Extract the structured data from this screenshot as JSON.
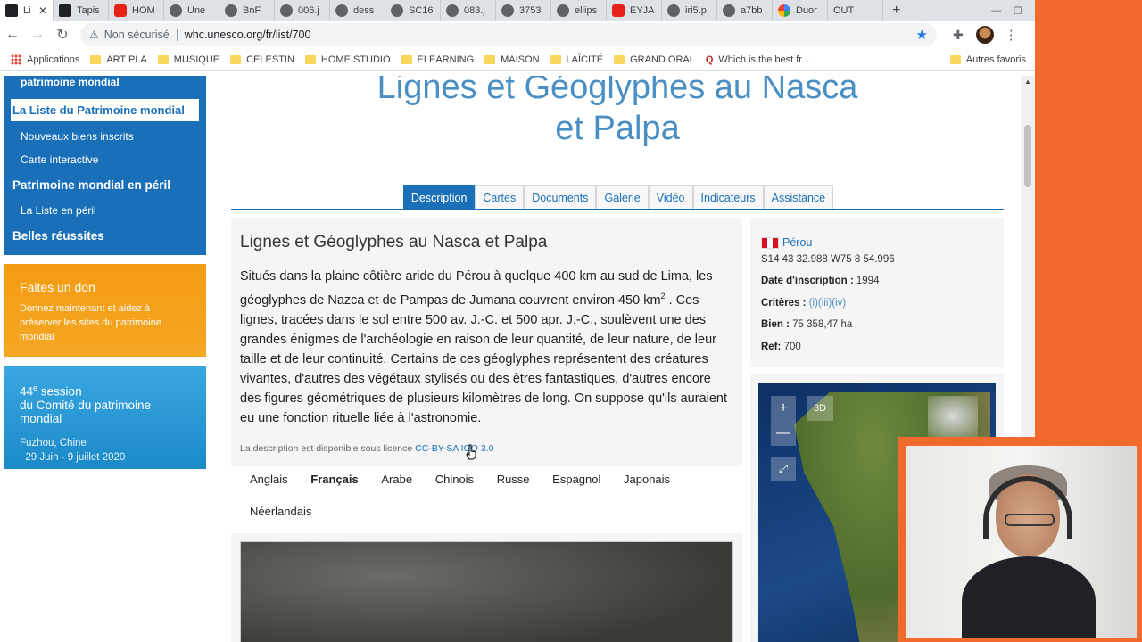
{
  "browser": {
    "tabs": [
      {
        "label": "Li",
        "icon": "unesco-icon",
        "active": true
      },
      {
        "label": "Tapis",
        "icon": "bnf-icon"
      },
      {
        "label": "HOM",
        "icon": "youtube-icon"
      },
      {
        "label": "Une",
        "icon": "globe-icon"
      },
      {
        "label": "BnF",
        "icon": "bracket-icon"
      },
      {
        "label": "006.j",
        "icon": "bracket-icon"
      },
      {
        "label": "dess",
        "icon": "globe-icon"
      },
      {
        "label": "SC16",
        "icon": "globe-icon"
      },
      {
        "label": "083.j",
        "icon": "bracket-icon"
      },
      {
        "label": "3753",
        "icon": "globe-icon"
      },
      {
        "label": "ellips",
        "icon": "globe-icon"
      },
      {
        "label": "EYJA",
        "icon": "youtube-icon"
      },
      {
        "label": "iri5.p",
        "icon": "globe-icon"
      },
      {
        "label": "a7bb",
        "icon": "globe-icon"
      },
      {
        "label": "Duor",
        "icon": "google-icon"
      },
      {
        "label": "OUT",
        "icon": "none"
      }
    ],
    "new_tab": "+",
    "omnibox": {
      "security_label": "Non sécurisé",
      "url": "whc.unesco.org/fr/list/700"
    },
    "bookmarks": [
      {
        "label": "Applications",
        "icon": "apps-icon"
      },
      {
        "label": "ART PLA",
        "icon": "folder-icon"
      },
      {
        "label": "MUSIQUE",
        "icon": "folder-icon"
      },
      {
        "label": "CELESTIN",
        "icon": "folder-icon"
      },
      {
        "label": "HOME STUDIO",
        "icon": "folder-icon"
      },
      {
        "label": "ELEARNING",
        "icon": "folder-icon"
      },
      {
        "label": "MAISON",
        "icon": "folder-icon"
      },
      {
        "label": "LAÏCITÉ",
        "icon": "folder-icon"
      },
      {
        "label": "GRAND ORAL",
        "icon": "folder-icon"
      },
      {
        "label": "Which is the best fr...",
        "icon": "quora-icon"
      }
    ],
    "other_bookmarks": "Autres favoris"
  },
  "sidebar": {
    "item_partial": "patrimoine mondial",
    "active_item": "La Liste du Patrimoine mondial",
    "sub_items_1": [
      "Nouveaux biens inscrits",
      "Carte interactive"
    ],
    "section_2": "Patrimoine mondial en péril",
    "sub_items_2": [
      "La Liste en péril"
    ],
    "section_3": "Belles réussites",
    "donate": {
      "title": "Faites un don",
      "text": "Donnez maintenant et aidez à préserver les sites du patrimoine mondial"
    },
    "session": {
      "num": "44",
      "num_sup": "e",
      "title_rest": " session",
      "title_line2": "du Comité du patrimoine mondial",
      "place": "Fuzhou, Chine",
      "dates": ", 29 Juin - 9 juillet 2020"
    }
  },
  "main": {
    "title_line1": "Lignes et Géoglyphes au Nasca",
    "title_line2": "et Palpa",
    "tabs": [
      "Description",
      "Cartes",
      "Documents",
      "Galerie",
      "Vidéo",
      "Indicateurs",
      "Assistance"
    ],
    "active_tab": "Description",
    "description": {
      "heading": "Lignes et Géoglyphes au Nasca et Palpa",
      "body_part1": "Situés dans la plaine côtière aride du Pérou à quelque 400 km au sud de Lima, les géoglyphes de Nazca et de Pampas de Jumana couvrent environ 450 km",
      "body_sup": "2",
      "body_part2": " . Ces lignes, tracées dans le sol entre 500 av. J.-C. et 500 apr. J.-C., soulèvent une des grandes énigmes de l'archéologie en raison de leur quantité, de leur nature, de leur taille et de leur continuité. Certains de ces géoglyphes représentent des créatures vivantes, d'autres des végétaux stylisés ou des êtres fantastiques, d'autres encore des figures géométriques de plusieurs kilomètres de long. On suppose qu'ils auraient eu une fonction rituelle liée à l'astronomie.",
      "license_text": "La description est disponible sous licence ",
      "license_link": "CC-BY-SA IGO 3.0"
    },
    "languages": [
      "Anglais",
      "Français",
      "Arabe",
      "Chinois",
      "Russe",
      "Espagnol",
      "Japonais",
      "Néerlandais"
    ],
    "selected_language": "Français"
  },
  "info": {
    "country": "Pérou",
    "coords": "S14 43 32.988 W75 8 54.996",
    "inscription_label": "Date d'inscription :",
    "inscription_value": "1994",
    "criteria_label": "Critères :",
    "criteria_value": "(i)(iii)(iv)",
    "property_label": "Bien :",
    "property_value": "75 358,47 ha",
    "ref_label": "Ref:",
    "ref_value": "700"
  },
  "map": {
    "zoom_in": "+",
    "zoom_out": "—",
    "mode_3d": "3D",
    "fullscreen": "⤢"
  },
  "colors": {
    "unesco_blue": "#1a70b8",
    "donate_orange": "#f5a623",
    "session_blue": "#1a8ac8",
    "webcam_frame": "#f26a2e"
  }
}
